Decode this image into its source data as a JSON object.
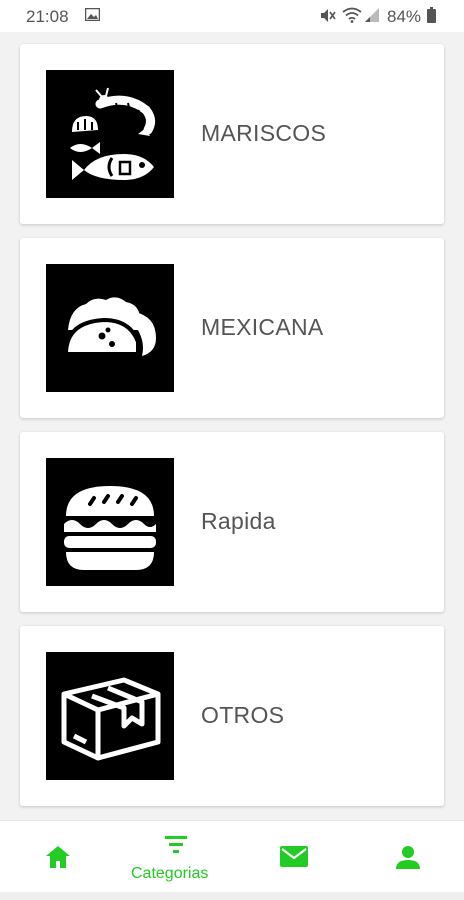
{
  "status_bar": {
    "time": "21:08",
    "battery_percent": "84%",
    "icons": [
      "gallery-icon",
      "mute-icon",
      "wifi-icon",
      "signal-icon",
      "battery-icon"
    ]
  },
  "categories": [
    {
      "label": "MARISCOS",
      "icon": "seafood-icon"
    },
    {
      "label": "MEXICANA",
      "icon": "taco-icon"
    },
    {
      "label": "Rapida",
      "icon": "burger-icon"
    },
    {
      "label": "OTROS",
      "icon": "box-icon"
    }
  ],
  "bottom_nav": {
    "accent_color": "#22cc22",
    "items": [
      {
        "icon": "home-icon",
        "label": ""
      },
      {
        "icon": "filter-icon",
        "label": "Categorias"
      },
      {
        "icon": "mail-icon",
        "label": ""
      },
      {
        "icon": "person-icon",
        "label": ""
      }
    ]
  }
}
